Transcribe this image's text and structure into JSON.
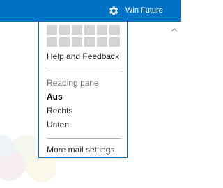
{
  "header": {
    "username": "Win Future",
    "icons": {
      "settings": "gear-icon",
      "scroll": "chevron-up-icon"
    }
  },
  "menu": {
    "tiles_count": 12,
    "help_label": "Help and Feedback",
    "reading_pane": {
      "label": "Reading pane",
      "options": [
        "Aus",
        "Rechts",
        "Unten"
      ],
      "selected": "Aus"
    },
    "more_settings_label": "More mail settings"
  },
  "colors": {
    "accent": "#0072c6",
    "tile": "#d4d4d4",
    "divider": "#b3b3b3"
  }
}
